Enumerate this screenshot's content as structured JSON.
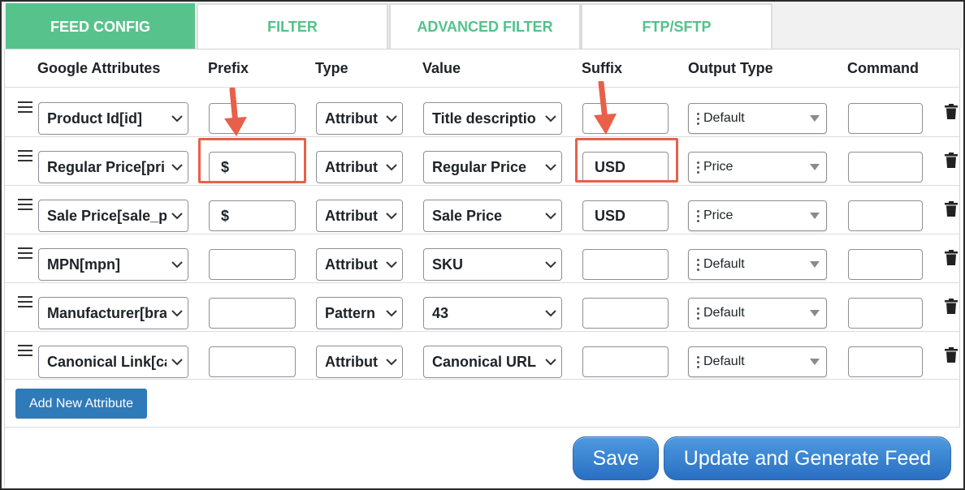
{
  "tabs": [
    {
      "label": "FEED CONFIG",
      "active": true
    },
    {
      "label": "FILTER",
      "active": false
    },
    {
      "label": "ADVANCED FILTER",
      "active": false
    },
    {
      "label": "FTP/SFTP",
      "active": false
    }
  ],
  "columns": {
    "google_attributes": "Google Attributes",
    "prefix": "Prefix",
    "type": "Type",
    "value": "Value",
    "suffix": "Suffix",
    "output_type": "Output Type",
    "command": "Command"
  },
  "rows": [
    {
      "attribute": "Product Id[id]",
      "prefix": "",
      "type": "Attribut",
      "value": "Title descriptio",
      "suffix": "",
      "output_type": "Default",
      "command": ""
    },
    {
      "attribute": "Regular Price[pri",
      "prefix": "$",
      "type": "Attribut",
      "value": "Regular Price",
      "suffix": "USD",
      "output_type": "Price",
      "command": ""
    },
    {
      "attribute": "Sale Price[sale_p",
      "prefix": "$",
      "type": "Attribut",
      "value": "Sale Price",
      "suffix": "USD",
      "output_type": "Price",
      "command": ""
    },
    {
      "attribute": "MPN[mpn]",
      "prefix": "",
      "type": "Attribut",
      "value": "SKU",
      "suffix": "",
      "output_type": "Default",
      "command": ""
    },
    {
      "attribute": "Manufacturer[bra",
      "prefix": "",
      "type": "Pattern",
      "value": "43",
      "suffix": "",
      "output_type": "Default",
      "command": ""
    },
    {
      "attribute": "Canonical Link[ca",
      "prefix": "",
      "type": "Attribut",
      "value": "Canonical URL",
      "suffix": "",
      "output_type": "Default",
      "command": ""
    }
  ],
  "buttons": {
    "add_attribute": "Add New Attribute",
    "save": "Save",
    "update_generate": "Update and Generate Feed"
  },
  "icons": {
    "drag": "drag-handle-icon",
    "chevron": "chevron-down-icon",
    "trash": "trash-icon",
    "annotation": "red-arrow-annotation"
  },
  "colors": {
    "tab_active": "#58c28c",
    "tab_text": "#52c28a",
    "primary_button": "#2f7ab9",
    "annotation": "#e8604a"
  }
}
